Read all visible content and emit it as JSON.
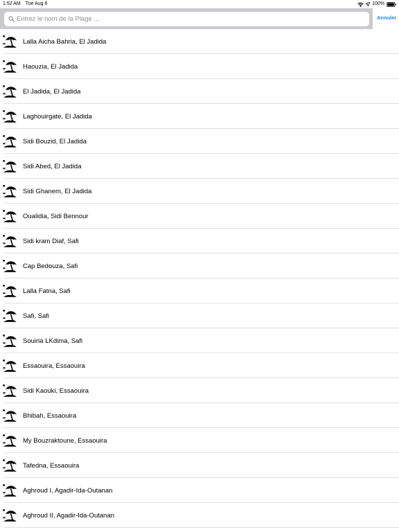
{
  "status_bar": {
    "time": "1:52 AM",
    "date": "Tue Aug 6",
    "battery": "100%"
  },
  "search": {
    "placeholder": "Entrez le nom de la Plage ...",
    "value": "",
    "cancel_label": "Annuler"
  },
  "colors": {
    "accent": "#1a86e8",
    "search_bar_bg": "#c9c9ce"
  },
  "list": {
    "icon": "beach-umbrella-icon",
    "items": [
      {
        "label": "Lalla Aicha Bahria, El Jadida"
      },
      {
        "label": "Haouzia, El Jadida"
      },
      {
        "label": "El Jadida, El Jadida"
      },
      {
        "label": "Laghouirgate, El Jadida"
      },
      {
        "label": "Sidi Bouzid, El Jadida"
      },
      {
        "label": "Sidi Abed, El Jadida"
      },
      {
        "label": "Sidi Ghanem, El Jadida"
      },
      {
        "label": "Oualidia, Sidi Bennour"
      },
      {
        "label": "Sidi kram Diaf, Safi"
      },
      {
        "label": "Cap Bedouza, Safi"
      },
      {
        "label": "Lalla Fatna, Safi"
      },
      {
        "label": "Safi, Safi"
      },
      {
        "label": "Souiria LKdima, Safi"
      },
      {
        "label": "Essaouira, Essaouira"
      },
      {
        "label": "Sidi Kaouki, Essaouira"
      },
      {
        "label": "Bhibah, Essaouira"
      },
      {
        "label": "My Bouzraktoune, Essaouira"
      },
      {
        "label": "Tafedna, Essaouira"
      },
      {
        "label": "Aghroud I, Agadir-Ida-Outanan"
      },
      {
        "label": "Aghroud II, Agadir-Ida-Outanan"
      }
    ]
  }
}
